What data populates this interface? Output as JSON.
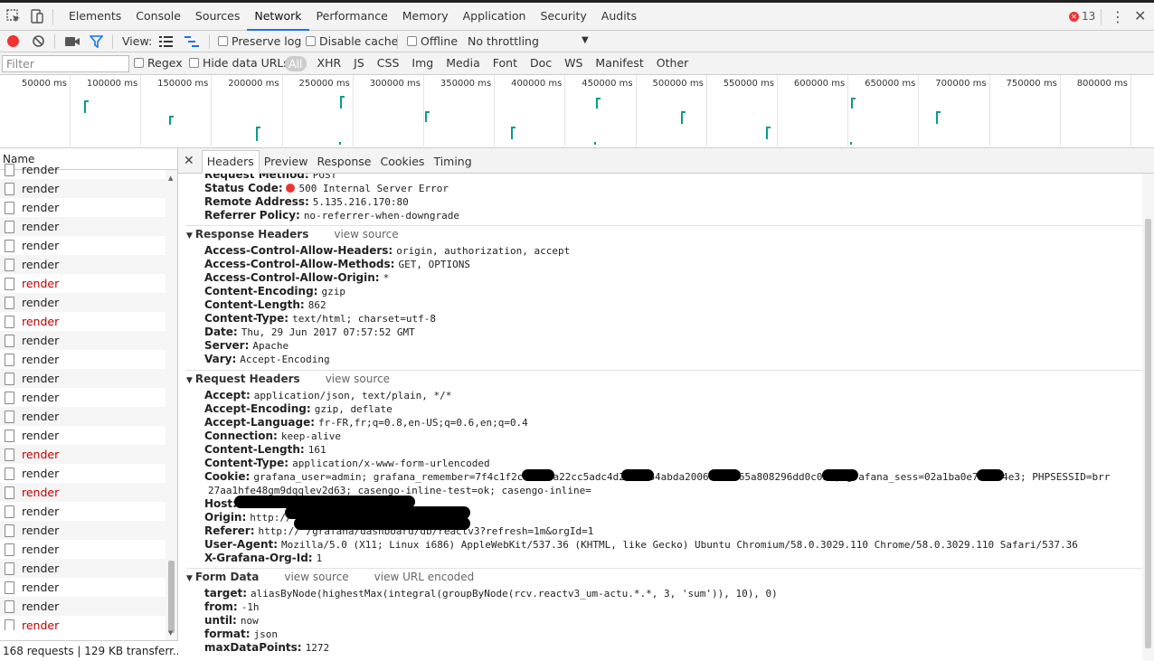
{
  "devtools": {
    "tabs": [
      "Elements",
      "Console",
      "Sources",
      "Network",
      "Performance",
      "Memory",
      "Application",
      "Security",
      "Audits"
    ],
    "active_tab": "Network",
    "error_count": "13",
    "icons": [
      "inspect-icon",
      "device-toggle-icon",
      "kebab-menu-icon",
      "close-icon",
      "error-icon"
    ]
  },
  "toolbar": {
    "view_label": "View:",
    "preserve_log": "Preserve log",
    "disable_cache": "Disable cache",
    "offline": "Offline",
    "throttling": "No throttling",
    "icons": [
      "record-icon",
      "clear-icon",
      "capture-screenshots-icon",
      "filter-icon",
      "large-rows-icon",
      "waterfall-icon",
      "dropdown-arrow-icon"
    ]
  },
  "filterbar": {
    "placeholder": "Filter",
    "regex": "Regex",
    "hide_data_urls": "Hide data URLs",
    "types": [
      "All",
      "XHR",
      "JS",
      "CSS",
      "Img",
      "Media",
      "Font",
      "Doc",
      "WS",
      "Manifest",
      "Other"
    ],
    "active_type": "All"
  },
  "overview": {
    "ticks": [
      "50000 ms",
      "100000 ms",
      "150000 ms",
      "200000 ms",
      "250000 ms",
      "300000 ms",
      "350000 ms",
      "400000 ms",
      "450000 ms",
      "500000 ms",
      "550000 ms",
      "600000 ms",
      "650000 ms",
      "700000 ms",
      "750000 ms",
      "800000 ms"
    ],
    "bar_color": "#0a9a8a"
  },
  "requests": {
    "column": "Name",
    "items": [
      {
        "name": "render",
        "error": false
      },
      {
        "name": "render",
        "error": false
      },
      {
        "name": "render",
        "error": false
      },
      {
        "name": "render",
        "error": false
      },
      {
        "name": "render",
        "error": false
      },
      {
        "name": "render",
        "error": false
      },
      {
        "name": "render",
        "error": true
      },
      {
        "name": "render",
        "error": false
      },
      {
        "name": "render",
        "error": true
      },
      {
        "name": "render",
        "error": false
      },
      {
        "name": "render",
        "error": false
      },
      {
        "name": "render",
        "error": false
      },
      {
        "name": "render",
        "error": false
      },
      {
        "name": "render",
        "error": false
      },
      {
        "name": "render",
        "error": false
      },
      {
        "name": "render",
        "error": true
      },
      {
        "name": "render",
        "error": false
      },
      {
        "name": "render",
        "error": true
      },
      {
        "name": "render",
        "error": false
      },
      {
        "name": "render",
        "error": false
      },
      {
        "name": "render",
        "error": false
      },
      {
        "name": "render",
        "error": false
      },
      {
        "name": "render",
        "error": false
      },
      {
        "name": "render",
        "error": false
      },
      {
        "name": "render",
        "error": true
      }
    ],
    "error_color": "#c00000",
    "summary": "168 requests  |  129 KB transferr..."
  },
  "detail": {
    "tabs": [
      "Headers",
      "Preview",
      "Response",
      "Cookies",
      "Timing"
    ],
    "active_tab": "Headers",
    "general": [
      {
        "k": "Request Method:",
        "v": "POST"
      },
      {
        "k": "Status Code:",
        "v": "500 Internal Server Error"
      },
      {
        "k": "Remote Address:",
        "v": "5.135.216.170:80"
      },
      {
        "k": "Referrer Policy:",
        "v": "no-referrer-when-downgrade"
      }
    ],
    "response_headers": {
      "title": "Response Headers",
      "view_source": "view source",
      "rows": [
        {
          "k": "Access-Control-Allow-Headers:",
          "v": "origin, authorization, accept"
        },
        {
          "k": "Access-Control-Allow-Methods:",
          "v": "GET, OPTIONS"
        },
        {
          "k": "Access-Control-Allow-Origin:",
          "v": "*"
        },
        {
          "k": "Content-Encoding:",
          "v": "gzip"
        },
        {
          "k": "Content-Length:",
          "v": "862"
        },
        {
          "k": "Content-Type:",
          "v": "text/html; charset=utf-8"
        },
        {
          "k": "Date:",
          "v": "Thu, 29 Jun 2017 07:57:52 GMT"
        },
        {
          "k": "Server:",
          "v": "Apache"
        },
        {
          "k": "Vary:",
          "v": "Accept-Encoding"
        }
      ]
    },
    "request_headers": {
      "title": "Request Headers",
      "view_source": "view source",
      "rows": [
        {
          "k": "Accept:",
          "v": "application/json, text/plain, */*"
        },
        {
          "k": "Accept-Encoding:",
          "v": "gzip, deflate"
        },
        {
          "k": "Accept-Language:",
          "v": "fr-FR,fr;q=0.8,en-US;q=0.6,en;q=0.4"
        },
        {
          "k": "Connection:",
          "v": "keep-alive"
        },
        {
          "k": "Content-Length:",
          "v": "161"
        },
        {
          "k": "Content-Type:",
          "v": "application/x-www-form-urlencoded"
        },
        {
          "k": "Cookie:",
          "v": "grafana_user=admin; grafana_remember=7f4c1f2c8f6b3a22cc5adc4d2a3e084abda2006a2b6765a808296dd0c0bd; grafana_sess=02a1ba0e743f64e3; PHPSESSID=brr"
        },
        {
          "k": "",
          "v": "27aa1hfe48gm9dqqlev2d63; casengo-inline-test=ok; casengo-inline="
        },
        {
          "k": "Host:",
          "v": ""
        },
        {
          "k": "Origin:",
          "v": "http://"
        },
        {
          "k": "Referer:",
          "v": "http://                                    /grafana/dashboard/db/reactv3?refresh=1m&orgId=1"
        },
        {
          "k": "User-Agent:",
          "v": "Mozilla/5.0 (X11; Linux i686) AppleWebKit/537.36 (KHTML, like Gecko) Ubuntu Chromium/58.0.3029.110 Chrome/58.0.3029.110 Safari/537.36"
        },
        {
          "k": "X-Grafana-Org-Id:",
          "v": "1"
        }
      ]
    },
    "form_data": {
      "title": "Form Data",
      "view_source": "view source",
      "view_url_encoded": "view URL encoded",
      "rows": [
        {
          "k": "target:",
          "v": "aliasByNode(highestMax(integral(groupByNode(rcv.reactv3_um-actu.*.*, 3, 'sum')), 10), 0)"
        },
        {
          "k": "from:",
          "v": "-1h"
        },
        {
          "k": "until:",
          "v": "now"
        },
        {
          "k": "format:",
          "v": "json"
        },
        {
          "k": "maxDataPoints:",
          "v": "1272"
        }
      ]
    }
  }
}
